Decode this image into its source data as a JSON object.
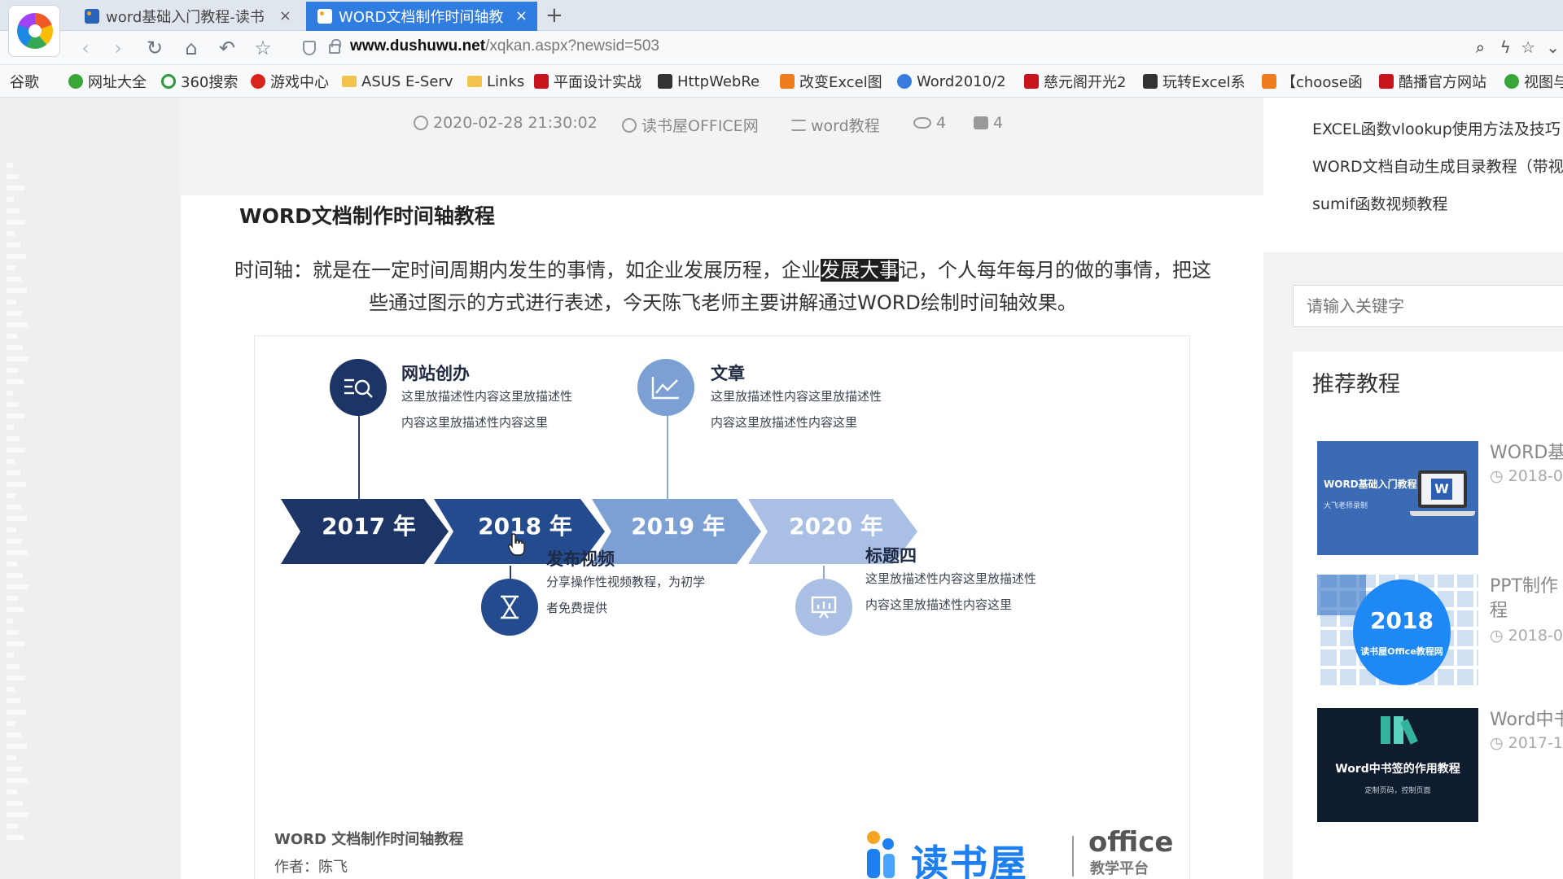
{
  "browser": {
    "tabs": [
      {
        "label": "word基础入门教程-读书",
        "active": false
      },
      {
        "label": "WORD文档制作时间轴教",
        "active": true
      }
    ],
    "close_glyph": "×",
    "new_tab_glyph": "+",
    "url_domain": "www.dushuwu.net",
    "url_path": "/xqkan.aspx?newsid=503",
    "nav_icons": {
      "back": "‹",
      "forward": "›",
      "reload": "↻",
      "home": "⌂",
      "undo": "↶",
      "star": "☆"
    },
    "right_icons": {
      "zoom": "⌕",
      "bolt": "ϟ",
      "favorite": "☆",
      "more": "⌄"
    },
    "bookmarks": [
      {
        "label": "谷歌",
        "icon": "page"
      },
      {
        "label": "网址大全",
        "icon": "green"
      },
      {
        "label": "360搜索",
        "icon": "ring"
      },
      {
        "label": "游戏中心",
        "icon": "red"
      },
      {
        "label": "ASUS E-Serv",
        "icon": "folder"
      },
      {
        "label": "Links",
        "icon": "folder"
      },
      {
        "label": "平面设计实战",
        "icon": "redsq"
      },
      {
        "label": "HttpWebRe",
        "icon": "dark"
      },
      {
        "label": "改变Excel图",
        "icon": "orange"
      },
      {
        "label": "Word2010/2",
        "icon": "blue"
      },
      {
        "label": "慈元阁开光2",
        "icon": "redsq"
      },
      {
        "label": "玩转Excel系",
        "icon": "dark"
      },
      {
        "label": "【choose函",
        "icon": "orange"
      },
      {
        "label": "酷播官方网站",
        "icon": "redsq"
      },
      {
        "label": "视图与",
        "icon": "green"
      }
    ]
  },
  "article": {
    "meta": {
      "date": "2020-02-28 21:30:02",
      "site": "读书屋OFFICE网",
      "category": "word教程",
      "views": "4",
      "comments": "4"
    },
    "title": "WORD文档制作时间轴教程",
    "intro_before": "时间轴：就是在一定时间周期内发生的事情，如企业发展历程，企业",
    "intro_highlight": "发展大事",
    "intro_after": "记，个人每年每月的做的事情，把这些通过图示的方式进行表述，今天陈飞老师主要讲解通过WORD绘制时间轴效果。"
  },
  "timeline": {
    "years": [
      "2017 年",
      "2018 年",
      "2019 年",
      "2020 年"
    ],
    "colors": [
      "#1d3467",
      "#234b8e",
      "#7c9fd4",
      "#a9bfe3"
    ],
    "events": [
      {
        "title": "网站创办",
        "desc": "这里放描述性内容这里放描述性内容这里放描述性内容这里",
        "icon": "search-list-icon"
      },
      {
        "title": "文章",
        "desc": "这里放描述性内容这里放描述性内容这里放描述性内容这里",
        "icon": "line-chart-icon"
      },
      {
        "title": "发布视频",
        "desc": "分享操作性视频教程，为初学者免费提供",
        "icon": "hourglass-icon"
      },
      {
        "title": "标题四",
        "desc": "这里放描述性内容这里放描述性内容这里放描述性内容这里",
        "icon": "presentation-icon"
      }
    ],
    "footer_title": "WORD 文档制作时间轴教程",
    "footer_author": "作者：陈飞",
    "logo_text": "读书屋",
    "logo_office": "office",
    "logo_sub": "教学平台"
  },
  "sidebar": {
    "links": [
      "EXCEL函数vlookup使用方法及技巧",
      "WORD文档自动生成目录教程（带视",
      "sumif函数视频教程"
    ],
    "search_placeholder": "请输入关键字",
    "recommended_title": "推荐教程",
    "items": [
      {
        "name": "WORD基",
        "date": "2018-0",
        "thumb_text": "WORD基础入门教程",
        "thumb_sub": "大飞老师录制"
      },
      {
        "name": "PPT制作",
        "name2": "程",
        "date": "2018-0",
        "thumb_text": "2018",
        "thumb_sub": "读书屋Office教程网"
      },
      {
        "name": "Word中书",
        "date": "2017-1",
        "thumb_text": "Word中书签的作用教程",
        "thumb_sub": "定制页码，控制页面"
      }
    ]
  }
}
